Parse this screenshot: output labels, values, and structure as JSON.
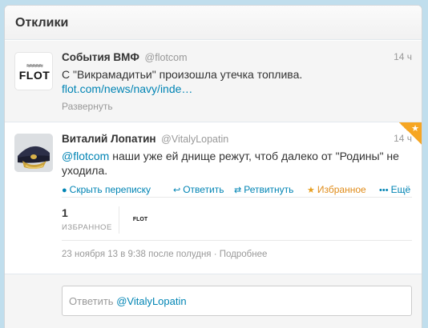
{
  "header": {
    "title": "Отклики"
  },
  "tweet1": {
    "fullname": "События ВМФ",
    "username": "@flotcom",
    "time": "14 ч",
    "text": "С \"Викрамадитьи\" произошла утечка топлива.",
    "link": "flot.com/news/navy/inde…",
    "expand_label": "Развернуть",
    "avatar_logo": "FLOT"
  },
  "tweet2": {
    "fullname": "Виталий Лопатин",
    "username": "@VitalyLopatin",
    "time": "14 ч",
    "mention": "@flotcom",
    "text": " наши уже ей днище режут, чтоб далеко от \"Родины\" не уходила.",
    "actions": {
      "hide": "Скрыть переписку",
      "reply": "Ответить",
      "retweet": "Ретвитнуть",
      "favorite": "Избранное",
      "more": "Ещё"
    },
    "favorites_count": "1",
    "favorites_label": "ИЗБРАННОЕ",
    "fav_avatar_logo": "FLOT",
    "timestamp": "23 ноября 13 в 9:38 после полудня",
    "source": "Подробнее"
  },
  "reply": {
    "prefix": "Ответить",
    "handle": "@VitalyLopatin"
  },
  "colors": {
    "link": "#0084b4",
    "favorite": "#f6a623",
    "background": "#c0deed"
  },
  "icons": [
    "bubble-icon",
    "reply-arrow-icon",
    "retweet-icon",
    "star-icon",
    "ellipsis-icon"
  ]
}
